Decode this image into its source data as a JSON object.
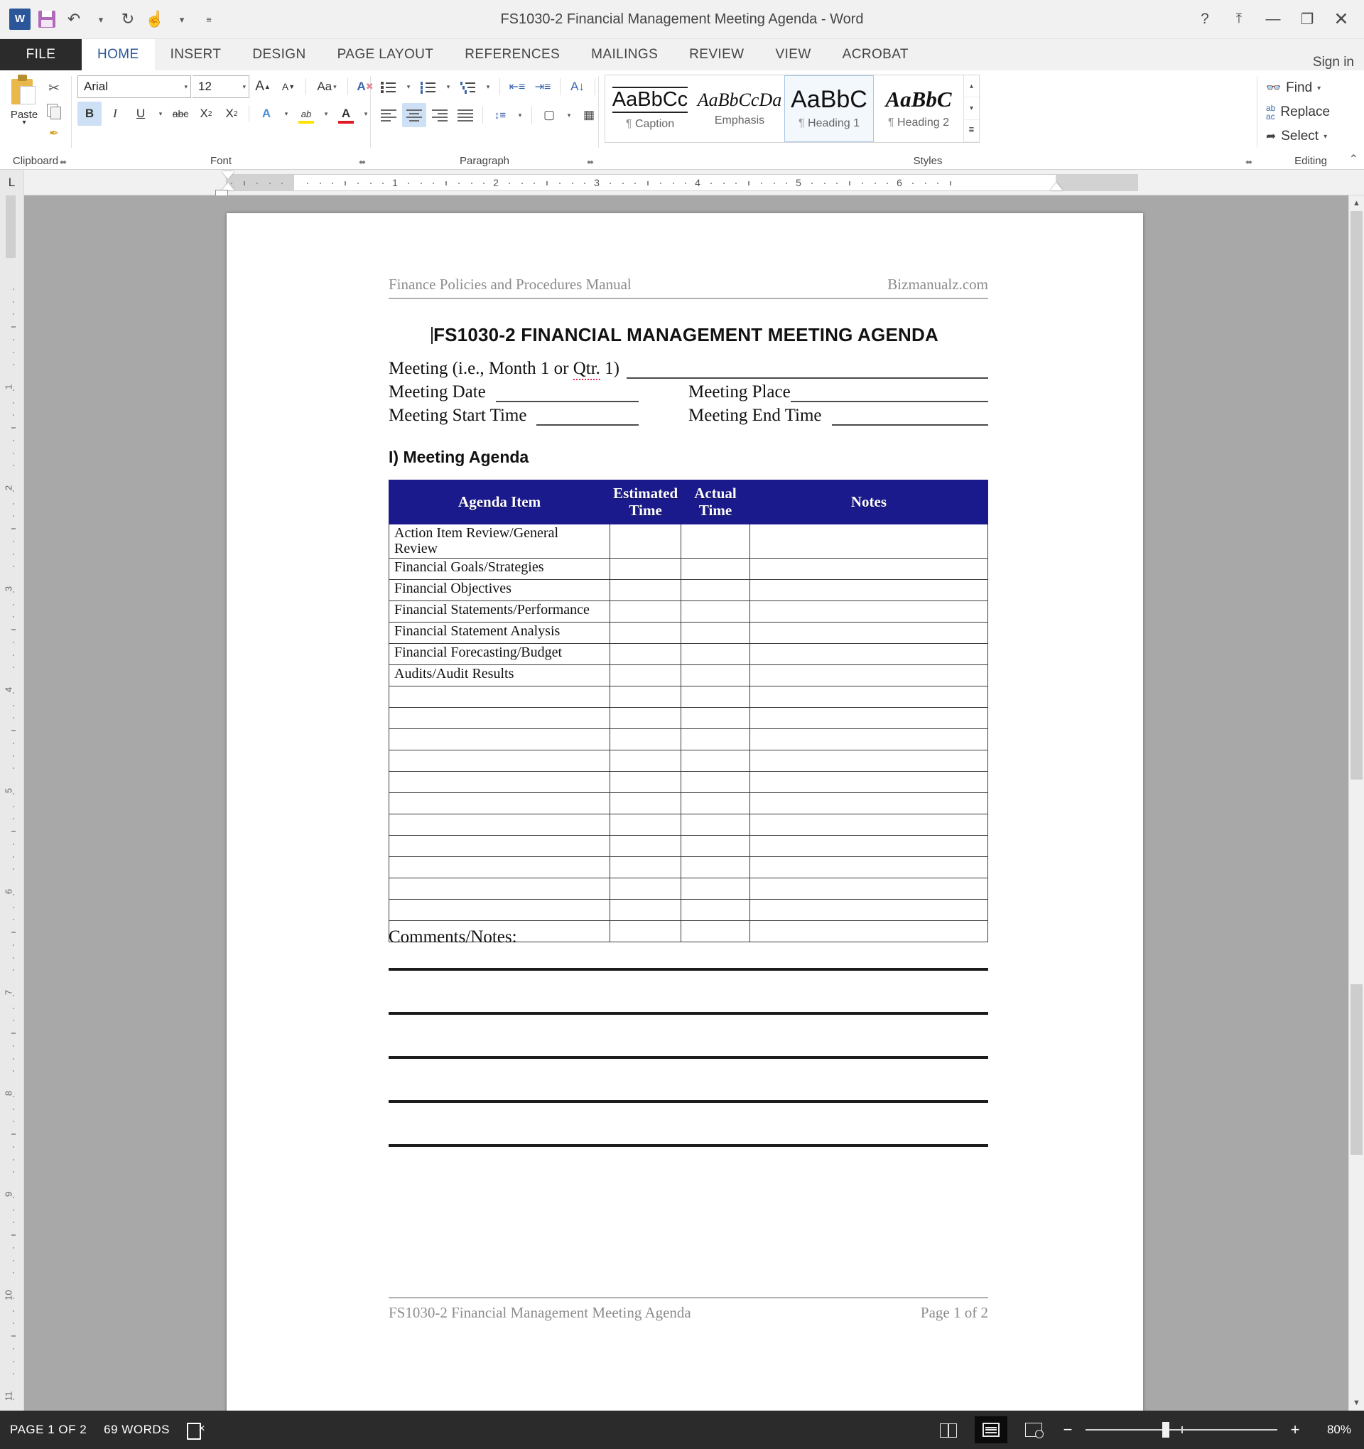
{
  "window": {
    "title": "FS1030-2 Financial Management Meeting Agenda - Word",
    "help_icon": "?",
    "ribbon_display_icon": "⤒",
    "minimize_icon": "—",
    "restore_icon": "❐",
    "close_icon": "✕"
  },
  "quick_access": {
    "word_logo": "W",
    "save_label": "Save",
    "undo_icon": "↶",
    "redo_icon": "↻",
    "touch_icon": "☝",
    "customize_icon": "≡"
  },
  "tabs": {
    "file": "FILE",
    "items": [
      "HOME",
      "INSERT",
      "DESIGN",
      "PAGE LAYOUT",
      "REFERENCES",
      "MAILINGS",
      "REVIEW",
      "VIEW",
      "ACROBAT"
    ],
    "active": "HOME",
    "sign_in": "Sign in"
  },
  "ribbon": {
    "clipboard": {
      "label": "Clipboard",
      "paste": "Paste",
      "paste_caret": "▾",
      "cut": "✂",
      "dialog_launcher": "⬌"
    },
    "font": {
      "label": "Font",
      "font_name": "Arial",
      "font_size": "12",
      "grow_font": "A",
      "shrink_font": "A",
      "change_case": "Aa",
      "clear_formatting": "A",
      "bold": "B",
      "italic": "I",
      "underline": "U",
      "strikethrough": "abc",
      "subscript": "X",
      "superscript": "X",
      "text_effects": "A",
      "highlight": "ab",
      "font_color": "A",
      "caret": "▾",
      "dialog_launcher": "⬌"
    },
    "paragraph": {
      "label": "Paragraph",
      "dialog_launcher": "⬌",
      "caret": "▾",
      "sort": "↓",
      "show_marks": "¶"
    },
    "styles": {
      "label": "Styles",
      "dialog_launcher": "⬌",
      "scroll_up": "▴",
      "scroll_down": "▾",
      "more": "≣",
      "gallery": [
        {
          "preview": "AaBbCc",
          "name": "Caption",
          "mark": "¶",
          "selected": false,
          "kind": "cap"
        },
        {
          "preview": "AaBbCcDa",
          "name": "Emphasis",
          "mark": "",
          "selected": false,
          "kind": "em"
        },
        {
          "preview": "AaBbC",
          "name": "Heading 1",
          "mark": "¶",
          "selected": true,
          "kind": "h1"
        },
        {
          "preview": "AaBbC",
          "name": "Heading 2",
          "mark": "¶",
          "selected": false,
          "kind": "h2"
        }
      ]
    },
    "editing": {
      "label": "Editing",
      "find": "Find",
      "replace": "Replace",
      "select": "Select",
      "find_caret": "▾",
      "select_caret": "▾",
      "collapse_ribbon": "⌃"
    }
  },
  "ruler": {
    "corner_tab": "L",
    "numbers": [
      "1",
      "1",
      "2",
      "3",
      "4",
      "5"
    ]
  },
  "document": {
    "header_left": "Finance Policies and Procedures Manual",
    "header_right": "Bizmanualz.com",
    "title": "FS1030-2 FINANCIAL MANAGEMENT MEETING AGENDA",
    "fields": [
      {
        "label": "Meeting (i.e., Month 1 or Qtr. 1)",
        "misspelled": "Qtr."
      },
      {
        "label": "Meeting Date",
        "label2": "Meeting Place"
      },
      {
        "label": "Meeting Start Time",
        "label2": "Meeting End Time"
      }
    ],
    "field_line1": "Meeting (i.e., Month 1 or ",
    "field_line1_misspell": "Qtr.",
    "field_line1_end": " 1)",
    "field_date": "Meeting Date",
    "field_place": "Meeting Place",
    "field_start": "Meeting Start Time",
    "field_end": "Meeting End Time",
    "section_heading": "I) Meeting Agenda",
    "table": {
      "columns": [
        "Agenda Item",
        "Estimated Time",
        "Actual Time",
        "Notes"
      ],
      "column_lines": [
        [
          "Agenda Item"
        ],
        [
          "Estimated",
          "Time"
        ],
        [
          "Actual",
          "Time"
        ],
        [
          "Notes"
        ]
      ],
      "rows": [
        {
          "item": "Action Item Review/General Review",
          "estimated": "",
          "actual": "",
          "notes": "",
          "tall": true
        },
        {
          "item": "Financial Goals/Strategies",
          "estimated": "",
          "actual": "",
          "notes": ""
        },
        {
          "item": "Financial Objectives",
          "estimated": "",
          "actual": "",
          "notes": ""
        },
        {
          "item": "Financial Statements/Performance",
          "estimated": "",
          "actual": "",
          "notes": ""
        },
        {
          "item": "Financial Statement Analysis",
          "estimated": "",
          "actual": "",
          "notes": ""
        },
        {
          "item": "Financial Forecasting/Budget",
          "estimated": "",
          "actual": "",
          "notes": ""
        },
        {
          "item": "Audits/Audit Results",
          "estimated": "",
          "actual": "",
          "notes": ""
        },
        {
          "item": "",
          "estimated": "",
          "actual": "",
          "notes": ""
        },
        {
          "item": "",
          "estimated": "",
          "actual": "",
          "notes": ""
        },
        {
          "item": "",
          "estimated": "",
          "actual": "",
          "notes": ""
        },
        {
          "item": "",
          "estimated": "",
          "actual": "",
          "notes": ""
        },
        {
          "item": "",
          "estimated": "",
          "actual": "",
          "notes": ""
        },
        {
          "item": "",
          "estimated": "",
          "actual": "",
          "notes": ""
        },
        {
          "item": "",
          "estimated": "",
          "actual": "",
          "notes": ""
        },
        {
          "item": "",
          "estimated": "",
          "actual": "",
          "notes": ""
        },
        {
          "item": "",
          "estimated": "",
          "actual": "",
          "notes": ""
        },
        {
          "item": "",
          "estimated": "",
          "actual": "",
          "notes": ""
        },
        {
          "item": "",
          "estimated": "",
          "actual": "",
          "notes": ""
        },
        {
          "item": "",
          "estimated": "",
          "actual": "",
          "notes": ""
        }
      ]
    },
    "comments_label": "Comments/Notes:",
    "comment_line_count": 5,
    "footer_left": "FS1030-2 Financial Management Meeting Agenda",
    "footer_right": "Page 1 of 2"
  },
  "status_bar": {
    "page": "PAGE 1 OF 2",
    "words": "69 WORDS",
    "proofing_icon": "proofing-errors-icon",
    "view_read": "read-mode-icon",
    "view_print": "print-layout-icon",
    "view_web": "web-layout-icon",
    "zoom_out": "−",
    "zoom_in": "+",
    "zoom_level": "80%"
  },
  "colors": {
    "table_header_bg": "#1a1a8c",
    "accent": "#2b579a",
    "statusbar_bg": "#2b2b2b",
    "file_tab_bg": "#2b2b2b"
  }
}
